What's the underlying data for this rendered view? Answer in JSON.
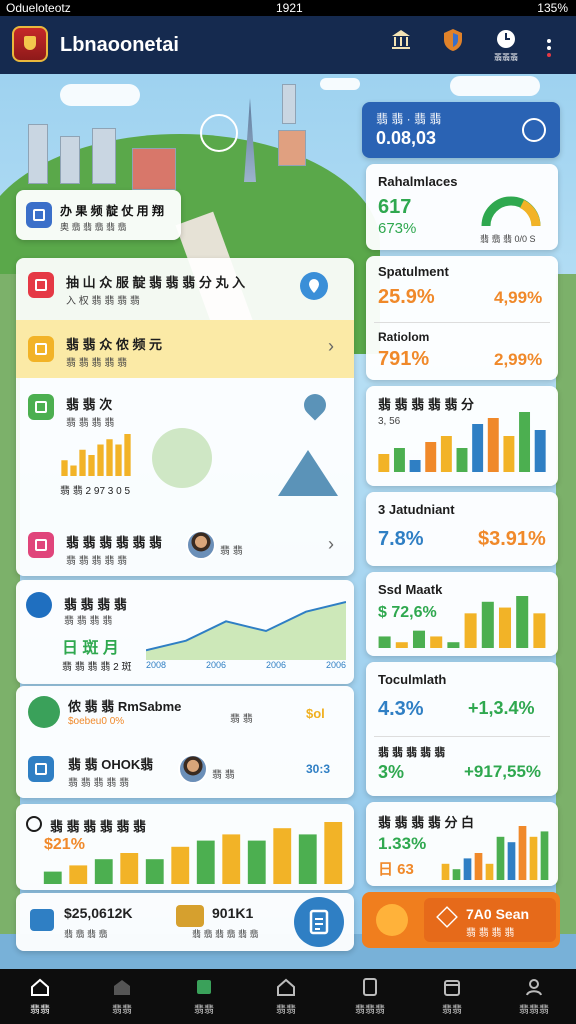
{
  "status_bar": {
    "left": "Odueloteotz",
    "time": "1921",
    "battery": "135%"
  },
  "app": {
    "title": "Lbnaoonetai",
    "actions": [
      {
        "label": ""
      },
      {
        "label": ""
      },
      {
        "label": "翡翡翡"
      }
    ]
  },
  "hero_card": {
    "title": "办 果 频 靛 仗 用 翔",
    "subtitle": "奥 翡 翡 翡 翡 翡"
  },
  "left_list": [
    {
      "title": "抽 山 众 服 靛 翡 翡 翡 分 丸 入",
      "subtitle": "入 权 翡 翡 翡 翡",
      "color": "#e53945"
    },
    {
      "title": "翡 翡 众 侬 频 元",
      "subtitle": "翡 翡 翡 翡 翡",
      "color": "#f2b327"
    },
    {
      "title": "翡 翡 次",
      "subtitle": "翡 翡 翡 翡",
      "color": "#4caf50",
      "chart_label": "翡 翡 2 97 3 0 5"
    },
    {
      "title": "翡 翡 翡 翡 翡 翡",
      "subtitle": "翡 翡 翡 翡 翡",
      "color": "#e0457b",
      "avatar_label": "翡 翡"
    }
  ],
  "trend_card": {
    "title": "翡 翡 翡 翡",
    "subtitle": "翡 翡 翡 翡",
    "value_label": "日 斑 月",
    "sub": "翡 翡 翡 翡 2 斑",
    "ticks": [
      "2008",
      "2006",
      "2006",
      "2006"
    ]
  },
  "promo_rows": [
    {
      "title": "侬 翡 翡 RmSabme",
      "subtitle": "$oebeu0 0%",
      "mid": "翡 翡",
      "right": "$ol"
    },
    {
      "title": "翡 翡 OHOK翡",
      "subtitle": "翡 翡 翡 翡 翡",
      "mid": "翡 翡",
      "right": "30:3"
    }
  ],
  "bottom_stats": {
    "title": "翡 翡 翡 翡 翡 翡",
    "value": "$21%"
  },
  "summary": [
    {
      "value": "$25,0612K",
      "label": "翡 翡 翡 翡"
    },
    {
      "value": "901K1",
      "label": "翡 翡 翡 翡 翡 翡"
    }
  ],
  "right_panel": {
    "header": {
      "title": "翡 翡 · 翡 翡",
      "value": "0.08,03"
    },
    "cards": [
      {
        "title": "Rahalmlaces",
        "a": "617",
        "b": "673%",
        "c": "翡 翡 翡 0/0 S"
      },
      {
        "title": "Spatulment",
        "a": "25.9%",
        "b": "4,99%"
      },
      {
        "title": "Ratiolom",
        "a": "791%",
        "b": "2,99%"
      },
      {
        "title": "翡 翡 翡 翡 翡 分",
        "a": "3, 56"
      },
      {
        "title": "3 Jatudniant",
        "a": "7.8%",
        "b": "$3.91%"
      },
      {
        "title": "Ssd Maatk",
        "a": "$ 72,6%"
      },
      {
        "title": "Toculmlath",
        "a": "4.3%",
        "b": "+1,3.4%"
      },
      {
        "title": "翡 翡 翡 翡 翡",
        "a": "3%",
        "b": "+917,55%"
      },
      {
        "title": "翡 翡 翡 翡 分 白",
        "a": "1.33%",
        "b": "日 63"
      }
    ],
    "cta": {
      "title": "7A0 Sean",
      "subtitle": "翡 翡 翡 翡"
    }
  },
  "bottom_nav": [
    {
      "label": "翡翡"
    },
    {
      "label": "翡翡"
    },
    {
      "label": "翡翡"
    },
    {
      "label": "翡翡"
    },
    {
      "label": "翡翡翡"
    },
    {
      "label": "翡翡"
    },
    {
      "label": "翡翡翡"
    }
  ],
  "chart_data": [
    {
      "type": "bar",
      "series": [
        {
          "values": [
            3,
            2,
            5,
            4,
            6,
            7,
            6,
            8
          ]
        }
      ]
    },
    {
      "type": "line",
      "series": [
        {
          "values": [
            1,
            2,
            4,
            3,
            5,
            6
          ]
        }
      ]
    },
    {
      "type": "bar",
      "series": [
        {
          "values": [
            2,
            3,
            4,
            5,
            4,
            6,
            7,
            8,
            7,
            9,
            8,
            10
          ]
        }
      ]
    },
    {
      "type": "bar",
      "series": [
        {
          "values": [
            3,
            4,
            2,
            5,
            6,
            4,
            8,
            9,
            6,
            10,
            7
          ]
        }
      ]
    },
    {
      "type": "bar",
      "series": [
        {
          "values": [
            2,
            1,
            3,
            2,
            1,
            6,
            8,
            7,
            9,
            6
          ]
        }
      ]
    },
    {
      "type": "bar",
      "series": [
        {
          "values": [
            3,
            2,
            4,
            5,
            3,
            8,
            7,
            10,
            8,
            9
          ]
        }
      ]
    }
  ]
}
